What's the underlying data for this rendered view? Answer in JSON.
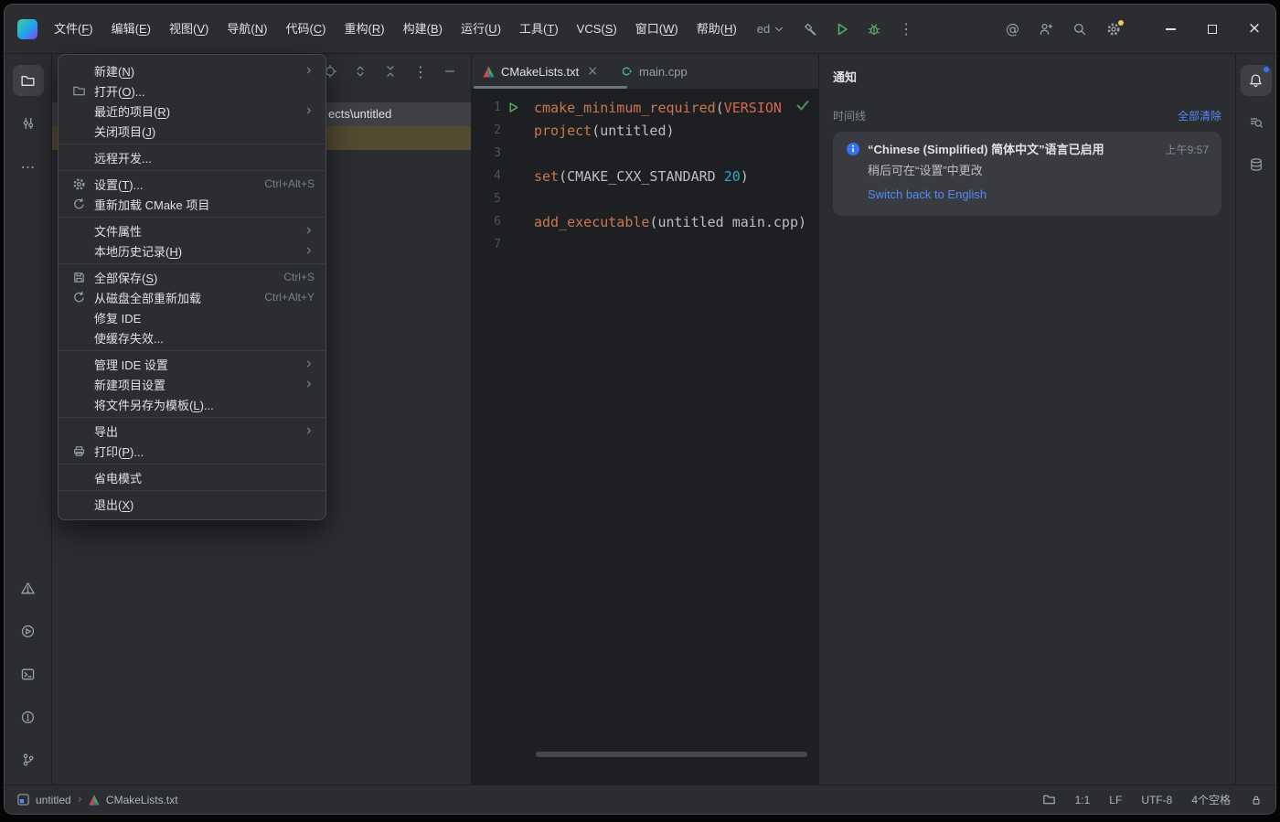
{
  "titlebar": {
    "menus": [
      "文件(F)",
      "编辑(E)",
      "视图(V)",
      "导航(N)",
      "代码(C)",
      "重构(R)",
      "构建(B)",
      "运行(U)",
      "工具(T)",
      "VCS(S)",
      "窗口(W)",
      "帮助(H)"
    ],
    "run_config": "ed"
  },
  "file_menu": {
    "items": {
      "new": "新建(N)",
      "open": "打开(O)...",
      "recent": "最近的项目(R)",
      "close_project": "关闭项目(J)",
      "remote_dev": "远程开发...",
      "settings": "设置(T)...",
      "settings_shortcut": "Ctrl+Alt+S",
      "reload_cmake": "重新加载 CMake 项目",
      "file_props": "文件属性",
      "local_history": "本地历史记录(H)",
      "save_all": "全部保存(S)",
      "save_all_shortcut": "Ctrl+S",
      "reload_disk": "从磁盘全部重新加载",
      "reload_disk_shortcut": "Ctrl+Alt+Y",
      "repair_ide": "修复 IDE",
      "invalidate_caches": "使缓存失效...",
      "manage_ide_settings": "管理 IDE 设置",
      "new_project_settings": "新建项目设置",
      "save_as_template": "将文件另存为模板(L)...",
      "export": "导出",
      "print": "打印(P)...",
      "power_save": "省电模式",
      "exit": "退出(X)"
    }
  },
  "project_panel": {
    "selected_row": "ects\\untitled"
  },
  "editor": {
    "tabs": [
      {
        "label": "CMakeLists.txt"
      },
      {
        "label": "main.cpp"
      }
    ],
    "line_numbers": [
      "1",
      "2",
      "3",
      "4",
      "5",
      "6",
      "7"
    ],
    "code": {
      "l1_cmd": "cmake_minimum_required",
      "l1_p": "(",
      "l1_kw": "VERSION",
      "l2_cmd": "project",
      "l2_rest": "(untitled)",
      "l4_cmd": "set",
      "l4_a": "(CMAKE_CXX_STANDARD ",
      "l4_num": "20",
      "l4_b": ")",
      "l6_cmd": "add_executable",
      "l6_rest": "(untitled main.cpp)"
    }
  },
  "notifications": {
    "title": "通知",
    "timeline": "时间线",
    "clear_all": "全部清除",
    "card": {
      "title": "“Chinese (Simplified) 简体中文”语言已启用",
      "time": "上午9:57",
      "body": "稍后可在“设置”中更改",
      "action": "Switch back to English"
    }
  },
  "status_bar": {
    "project": "untitled",
    "file": "CMakeLists.txt",
    "caret": "1:1",
    "line_ending": "LF",
    "encoding": "UTF-8",
    "indent": "4个空格"
  },
  "colors": {
    "accent_blue": "#548af7",
    "run_green": "#5cad65",
    "warning_yellow": "#f2c55c",
    "panel_bg": "#2b2d30",
    "editor_bg": "#1e1f22"
  }
}
